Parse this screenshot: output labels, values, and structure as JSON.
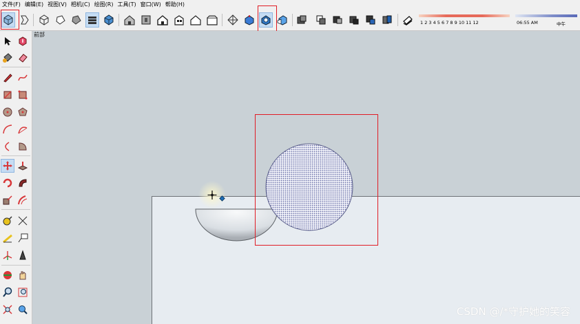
{
  "menu": [
    "文件(F)",
    "编辑(E)",
    "视图(V)",
    "相机(C)",
    "绘图(R)",
    "工具(T)",
    "窗口(W)",
    "帮助(H)"
  ],
  "toolbar": {
    "icons": [
      "xray-cube-icon",
      "back-edges-icon",
      "wireframe-icon",
      "hidden-line-icon",
      "shaded-icon",
      "shaded-textures-icon",
      "monochrome-icon",
      "iso-view-icon",
      "top-view-icon",
      "front-view-icon",
      "right-view-icon",
      "back-view-icon",
      "left-view-icon",
      "section-plane-icon",
      "outer-shell-icon",
      "intersect-icon",
      "union-icon",
      "subtract-icon",
      "trim-icon",
      "split-icon",
      "shadows-icon"
    ],
    "month_ticks": "1 2 3 4 5 6 7 8 9 10 11 12",
    "time_left": "06:55 AM",
    "time_right": "中午"
  },
  "viewport": {
    "view_label": "前部"
  },
  "sidebar": {
    "icons": [
      "select-arrow-icon",
      "make-component-icon",
      "paint-bucket-icon",
      "eraser-icon",
      "pencil-icon",
      "freehand-icon",
      "rectangle-icon",
      "rotated-rectangle-icon",
      "circle-icon",
      "polygon-icon",
      "arc-icon",
      "two-point-arc-icon",
      "three-point-arc-icon",
      "pie-icon",
      "move-icon",
      "push-pull-icon",
      "rotate-icon",
      "follow-me-icon",
      "scale-icon",
      "offset-icon",
      "tape-measure-icon",
      "dimension-icon",
      "protractor-icon",
      "text-icon",
      "axes-icon",
      "3d-text-icon",
      "orbit-icon",
      "pan-icon",
      "zoom-icon",
      "zoom-window-icon",
      "zoom-extents-icon",
      "previous-view-icon"
    ]
  },
  "watermark": "CSDN @/*守护她的笑容",
  "colors": {
    "highlight": "#e01b24",
    "sky": "#c9d1d6",
    "ground": "#e7ecf1"
  }
}
